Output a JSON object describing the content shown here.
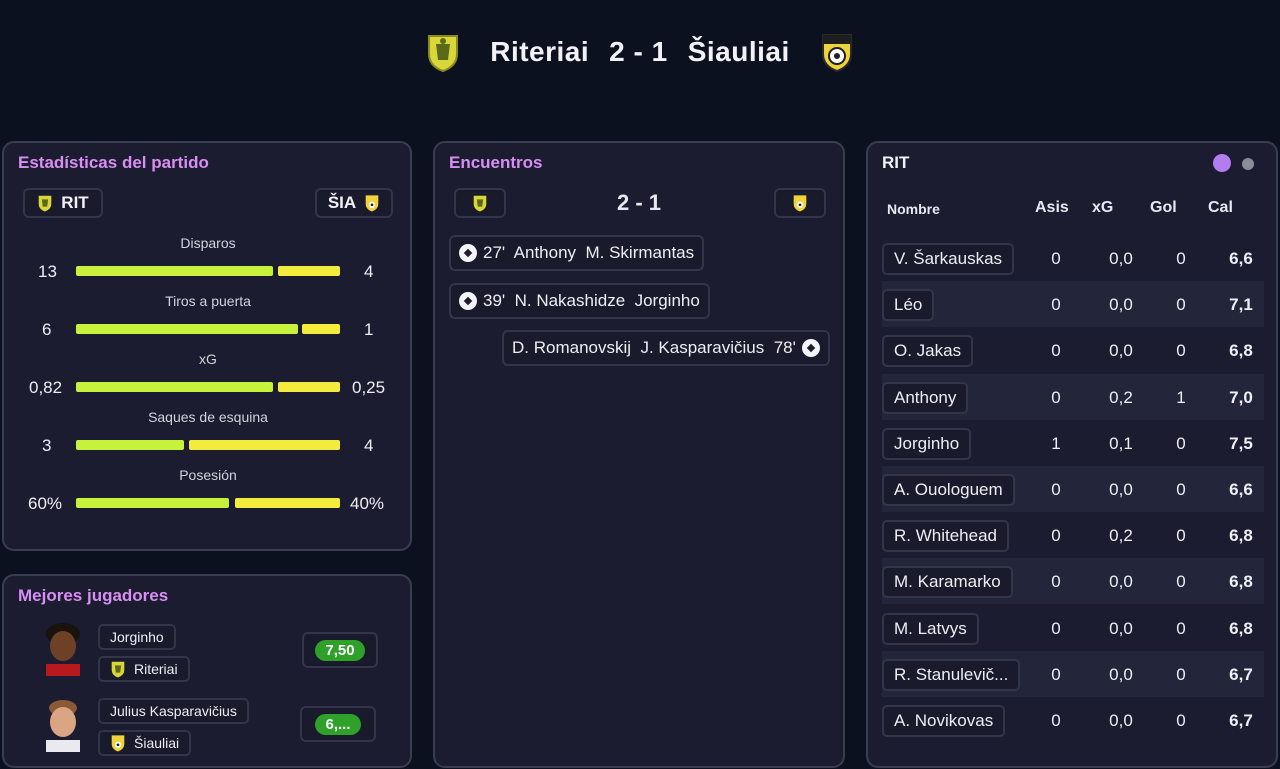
{
  "header": {
    "home_team": "Riteriai",
    "score": "2 - 1",
    "away_team": "Šiauliai"
  },
  "stats": {
    "title": "Estadísticas del partido",
    "home_abbr": "RIT",
    "away_abbr": "ŠIA",
    "rows": [
      {
        "label": "Disparos",
        "home": "13",
        "away": "4"
      },
      {
        "label": "Tiros a puerta",
        "home": "6",
        "away": "1"
      },
      {
        "label": "xG",
        "home": "0,82",
        "away": "0,25"
      },
      {
        "label": "Saques de esquina",
        "home": "3",
        "away": "4"
      },
      {
        "label": "Posesión",
        "home": "60%",
        "away": "40%"
      }
    ]
  },
  "top_players": {
    "title": "Mejores jugadores",
    "players": [
      {
        "name": "Jorginho",
        "club": "Riteriai",
        "rating": "7,50"
      },
      {
        "name": "Julius Kasparavičius",
        "club": "Šiauliai",
        "rating": "6,..."
      }
    ]
  },
  "events": {
    "title": "Encuentros",
    "score": "2 - 1",
    "items": [
      {
        "text": "27'  Anthony  M. Skirmantas"
      },
      {
        "text": "39'  N. Nakashidze  Jorginho"
      },
      {
        "text": "D. Romanovskij  J. Kasparavičius  78'"
      }
    ]
  },
  "roster": {
    "team": "RIT",
    "columns": [
      "Nombre",
      "Asis",
      "xG",
      "Gol",
      "Cal"
    ],
    "rows": [
      {
        "name": "V. Šarkauskas",
        "asis": "0",
        "xg": "0,0",
        "gol": "0",
        "cal": "6,6"
      },
      {
        "name": "Léo",
        "asis": "0",
        "xg": "0,0",
        "gol": "0",
        "cal": "7,1"
      },
      {
        "name": "O. Jakas",
        "asis": "0",
        "xg": "0,0",
        "gol": "0",
        "cal": "6,8"
      },
      {
        "name": "Anthony",
        "asis": "0",
        "xg": "0,2",
        "gol": "1",
        "cal": "7,0"
      },
      {
        "name": "Jorginho",
        "asis": "1",
        "xg": "0,1",
        "gol": "0",
        "cal": "7,5"
      },
      {
        "name": "A. Ouologuem",
        "asis": "0",
        "xg": "0,0",
        "gol": "0",
        "cal": "6,6"
      },
      {
        "name": "R. Whitehead",
        "asis": "0",
        "xg": "0,2",
        "gol": "0",
        "cal": "6,8"
      },
      {
        "name": "M. Karamarko",
        "asis": "0",
        "xg": "0,0",
        "gol": "0",
        "cal": "6,8"
      },
      {
        "name": "M. Latvys",
        "asis": "0",
        "xg": "0,0",
        "gol": "0",
        "cal": "6,8"
      },
      {
        "name": "R. Stanulevič...",
        "asis": "0",
        "xg": "0,0",
        "gol": "0",
        "cal": "6,7"
      },
      {
        "name": "A. Novikovas",
        "asis": "0",
        "xg": "0,0",
        "gol": "0",
        "cal": "6,7"
      }
    ]
  },
  "colors": {
    "accent": "#d88ef3",
    "home_bar": "#c7f13a",
    "away_bar": "#f4ec3c",
    "rating": "#2fa12a",
    "dot_active": "#b47cf0",
    "dot_inactive": "#8a8d99"
  },
  "icons": {
    "goal": "soccer-ball-icon",
    "home_crest": "riteriai-crest-icon",
    "away_crest": "siauliai-crest-icon"
  }
}
